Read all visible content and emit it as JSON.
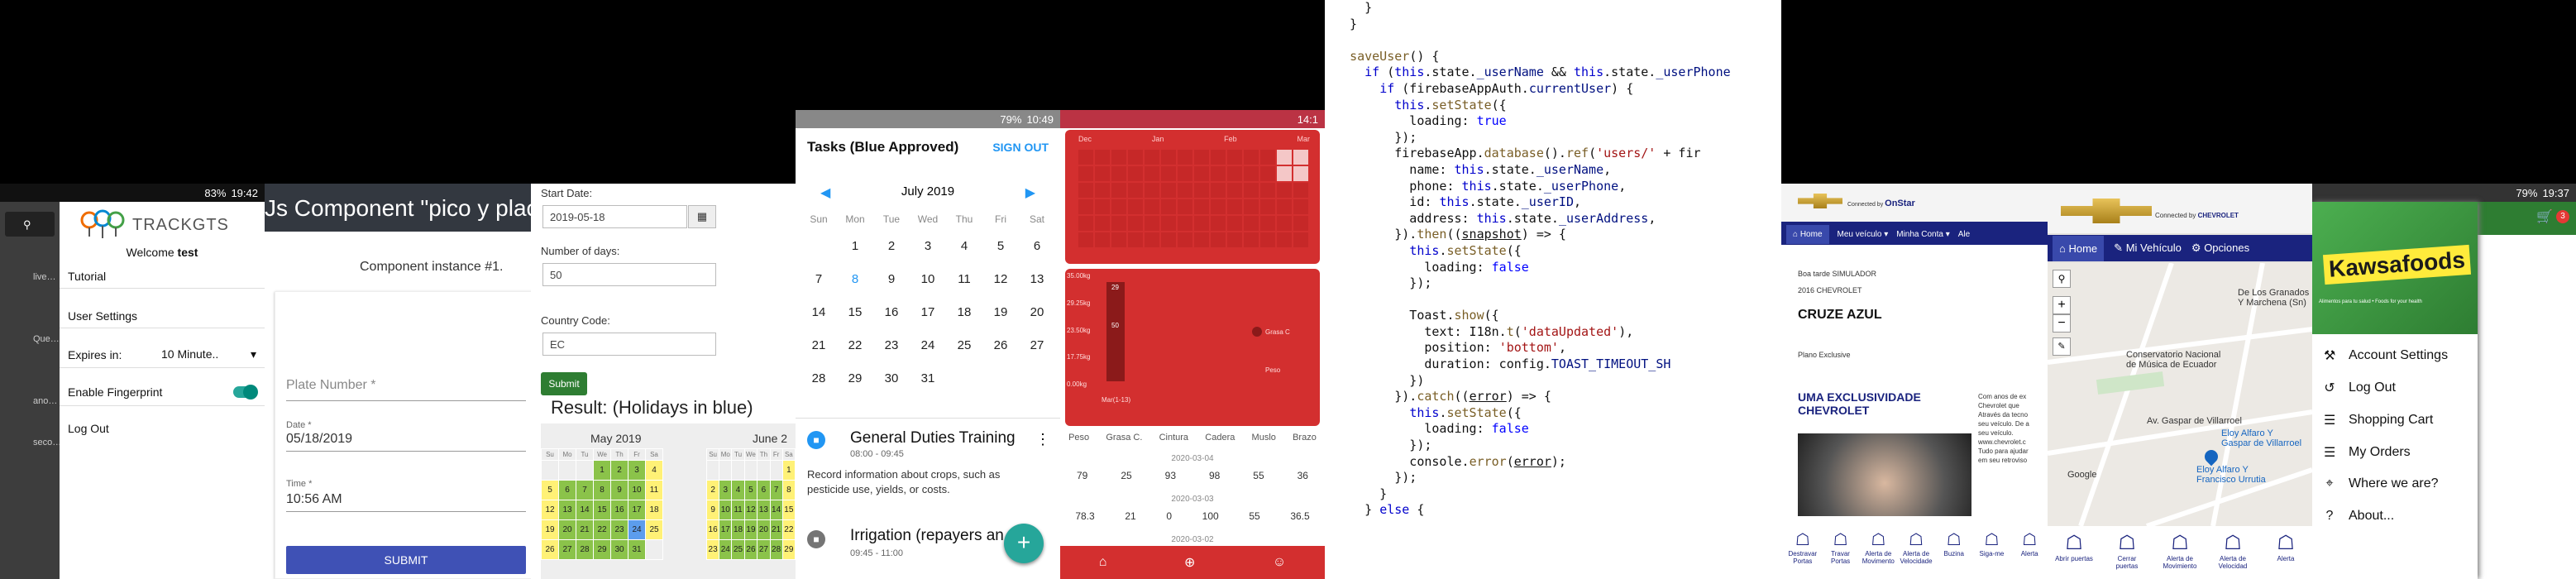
{
  "p1": {
    "status": {
      "time": "19:42",
      "battery": "83%"
    },
    "brand": "TRACKGTS",
    "welcome": "Welcome",
    "user": "test",
    "items": {
      "tutorial": "Tutorial",
      "settings": "User Settings",
      "expires_label": "Expires in:",
      "expires_value": "10 Minute..",
      "fingerprint": "Enable Fingerprint",
      "logout": "Log Out"
    },
    "behind": [
      "live…",
      "Que…",
      "ano…",
      "seco…"
    ]
  },
  "p2": {
    "header": "Js Component \"pico y placa\"",
    "instance": "Component instance #1.",
    "plate_placeholder": "Plate Number *",
    "date_label": "Date *",
    "date_value": "05/18/2019",
    "time_label": "Time *",
    "time_value": "10:56 AM",
    "submit": "SUBMIT"
  },
  "p3": {
    "start_label": "Start Date:",
    "start_value": "2019-05-18",
    "days_label": "Number of days:",
    "days_value": "50",
    "country_label": "Country Code:",
    "country_value": "EC",
    "submit": "Submit",
    "result": "Result: (Holidays in blue)",
    "month1": "May 2019",
    "month2": "June 2",
    "dow": [
      "Su",
      "Mo",
      "Tu",
      "We",
      "Th",
      "Fr",
      "Sa"
    ],
    "weeks": [
      [
        "",
        "",
        "",
        "1",
        "2",
        "3",
        "4"
      ],
      [
        "5",
        "6",
        "7",
        "8",
        "9",
        "10",
        "11"
      ],
      [
        "12",
        "13",
        "14",
        "15",
        "16",
        "17",
        "18"
      ],
      [
        "19",
        "20",
        "21",
        "22",
        "23",
        "24",
        "25"
      ],
      [
        "26",
        "27",
        "28",
        "29",
        "30",
        "31",
        ""
      ]
    ],
    "june": [
      [
        "",
        "",
        "",
        "",
        "",
        "",
        "1"
      ],
      [
        "2",
        "3",
        "4",
        "5",
        "6",
        "7",
        "8"
      ],
      [
        "9",
        "10",
        "11",
        "12",
        "13",
        "14",
        "15"
      ],
      [
        "16",
        "17",
        "18",
        "19",
        "20",
        "21",
        "22"
      ],
      [
        "23",
        "24",
        "25",
        "26",
        "27",
        "28",
        "29"
      ]
    ]
  },
  "p4": {
    "status": {
      "time": "10:49",
      "battery": "79%"
    },
    "title": "Tasks (Blue Approved)",
    "signout": "SIGN OUT",
    "month": "July 2019",
    "dow": [
      "Sun",
      "Mon",
      "Tue",
      "Wed",
      "Thu",
      "Fri",
      "Sat"
    ],
    "weeks": [
      [
        "",
        "1",
        "2",
        "3",
        "4",
        "5",
        "6"
      ],
      [
        "7",
        "8",
        "9",
        "10",
        "11",
        "12",
        "13"
      ],
      [
        "14",
        "15",
        "16",
        "17",
        "18",
        "19",
        "20"
      ],
      [
        "21",
        "22",
        "23",
        "24",
        "25",
        "26",
        "27"
      ],
      [
        "28",
        "29",
        "30",
        "31",
        "",
        "",
        ""
      ]
    ],
    "task1": {
      "title": "General Duties Training",
      "time": "08:00 - 09:45",
      "desc": "Record information about crops, such as pesticide use, yields, or costs."
    },
    "task2": {
      "title": "Irrigation (repayers an",
      "time": "09:45 - 11:00"
    },
    "fab": "+"
  },
  "p5": {
    "status": {
      "time": "14:1"
    },
    "months": [
      "Dec",
      "Jan",
      "Feb",
      "Mar"
    ],
    "yticks": [
      "35.00kg",
      "29.25kg",
      "23.50kg",
      "17.75kg",
      "0.00kg"
    ],
    "mid_vals": [
      "29",
      "50"
    ],
    "legend1": "Grasa C",
    "legend2": "Peso",
    "xlab": "Mar(1-13)",
    "table": {
      "headers": [
        "Peso",
        "Grasa C.",
        "Cintura",
        "Cadera",
        "Muslo",
        "Brazo"
      ],
      "rows": [
        {
          "date": "2020-03-04",
          "vals": [
            "79",
            "25",
            "93",
            "98",
            "55",
            "36"
          ]
        },
        {
          "date": "2020-03-03",
          "vals": [
            "78.3",
            "21",
            "0",
            "100",
            "55",
            "36.5"
          ]
        },
        {
          "date": "2020-03-02",
          "vals": []
        }
      ]
    }
  },
  "p6": {
    "code": "code"
  },
  "p7": {
    "connected": "Connected by",
    "onstar": "OnStar",
    "home": "Home",
    "myveh": "Meu veículo",
    "account": "Minha Conta",
    "alert": "Ale",
    "greet": "Boa tarde",
    "user": "SIMULADOR",
    "year": "2016 CHEVROLET",
    "model": "CRUZE AZUL",
    "plan": "Plano Exclusive",
    "promo1": "UMA EXCLUSIVIDADE",
    "promo2": "CHEVROLET",
    "side": [
      "Com anos de ex",
      "Chevrolet que",
      "Através da tecno",
      "seu veículo. De a",
      "seu veículo.",
      "www.chevrolet.c",
      "Tudo para ajudar",
      "em seu retroviso"
    ],
    "icons": [
      "Destravar Portas",
      "Travar Portas",
      "Alerta de Movimento",
      "Alerta de Velocidade",
      "Buzina",
      "Siga-me",
      "Alerta"
    ]
  },
  "p8": {
    "connected": "Connected by",
    "chevy": "CHEVROLET",
    "home": "Home",
    "myveh": "Mi Vehículo",
    "options": "Opciones",
    "labels": [
      "De Los Granados",
      "Y Marchena (Sn)",
      "Conservatorio Nacional",
      "de Música de Ecuador",
      "Av. Gaspar de Villarroel",
      "Eloy Alfaro Y",
      "Gaspar de Villarroel",
      "Eloy Alfaro Y",
      "Francisco Urrutia",
      "Google"
    ],
    "icons": [
      "Abrir puertas",
      "Cerrar puertas",
      "Alerta de Movimiento",
      "Alerta de Velocidad",
      "Alerta"
    ]
  },
  "p9": {
    "status": {
      "time": "19:37",
      "battery": "79%"
    },
    "brand": "Kawsafoods",
    "tagline": "Alimentos para tu salud • Foods for your health",
    "cart_count": "3",
    "menu": [
      "Account Settings",
      "Log Out",
      "Shopping Cart",
      "My Orders",
      "Where we are?",
      "About..."
    ]
  },
  "colors": {
    "red": "#d32f2f",
    "green": "#2e7d32",
    "blue": "#3f51b5",
    "teal": "#26a69a",
    "navy": "#1a237e"
  }
}
